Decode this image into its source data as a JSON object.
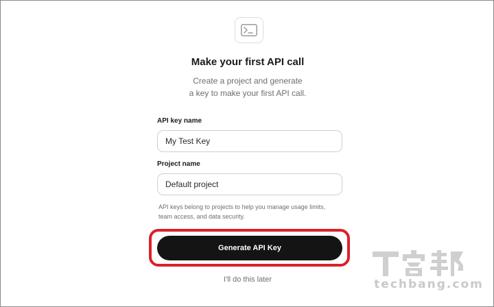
{
  "header": {
    "icon": "terminal-icon",
    "title": "Make your first API call",
    "subtitle_line1": "Create a project and generate",
    "subtitle_line2": "a key to make your first API call."
  },
  "form": {
    "api_key_name": {
      "label": "API key name",
      "value": "My Test Key"
    },
    "project_name": {
      "label": "Project name",
      "value": "Default project"
    },
    "helper_line1": "API keys belong to projects to help you manage usage limits,",
    "helper_line2": "team access, and data security."
  },
  "actions": {
    "generate_label": "Generate API Key",
    "later_label": "I'll do this later"
  },
  "watermark": {
    "logo_text": "T客邦",
    "url_text": "techbang.com"
  },
  "colors": {
    "primary_button": "#141414",
    "highlight": "#d9202a"
  }
}
